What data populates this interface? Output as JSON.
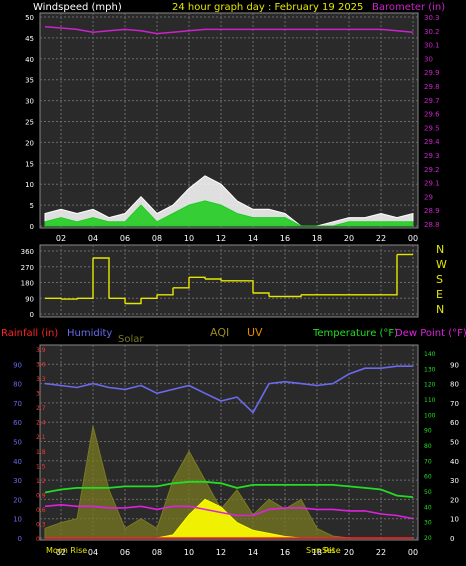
{
  "header": {
    "left_label": "Windspeed (mph)",
    "title": "24 hour graph day : February 19 2025",
    "right_label": "Barometer (in)"
  },
  "colors": {
    "background": "#000000",
    "plot_bg": "#2a2a2a",
    "grid": "#6a6a6a",
    "wind_gust": "#ffffff",
    "wind_avg": "#22cc22",
    "barometer": "#cc22cc",
    "direction": "#e6e600",
    "rainfall": "#ff2222",
    "humidity": "#6a6aee",
    "solar": "#7a7a22",
    "aqi": "#9a8a20",
    "uv": "#e08a00",
    "temperature": "#22dd22",
    "dew_point": "#dd22dd",
    "rain_axis": "#ff3333",
    "temp_axis": "#22dd22",
    "fill_yellow": "#ffff00"
  },
  "x_axis": {
    "ticks": [
      "02",
      "04",
      "06",
      "08",
      "10",
      "12",
      "14",
      "16",
      "18",
      "20",
      "22",
      "00"
    ],
    "sun_moon_labels": [
      "Moon Rise",
      "Sun Rise",
      "Set"
    ]
  },
  "panel1": {
    "left_ticks": [
      "0",
      "5",
      "10",
      "15",
      "20",
      "25",
      "30",
      "35",
      "40",
      "45",
      "50"
    ],
    "right_ticks": [
      "28.8",
      "28.9",
      "29",
      "29.1",
      "29.2",
      "29.3",
      "29.4",
      "29.5",
      "29.6",
      "29.7",
      "29.8",
      "29.9",
      "30",
      "30.1",
      "30.2",
      "30.3"
    ]
  },
  "panel2": {
    "left_ticks": [
      "0",
      "90",
      "180",
      "270",
      "360"
    ],
    "compass": [
      "N",
      "W",
      "S",
      "E",
      "N"
    ]
  },
  "panel3": {
    "legend": {
      "rainfall": "Rainfall (in)",
      "humidity": "Humidity",
      "solar": "Solar",
      "aqi": "AQI",
      "uv": "UV",
      "temperature": "Temperature (°F)",
      "dew_point": "Dew Point (°F)"
    },
    "humidity_ticks": [
      "0",
      "10",
      "20",
      "30",
      "40",
      "50",
      "60",
      "70",
      "80",
      "90"
    ],
    "rain_ticks": [
      "0",
      "0.3",
      "0.6",
      "0.9",
      "1.2",
      "1.5",
      "1.8",
      "2.1",
      "2.4",
      "2.7",
      "3",
      "3.3",
      "3.6",
      "3.9"
    ],
    "temp_ticks": [
      "20",
      "30",
      "40",
      "50",
      "60",
      "70",
      "80",
      "90",
      "100",
      "110",
      "120",
      "130",
      "140"
    ],
    "right_ticks": [
      "0",
      "10",
      "20",
      "30",
      "40",
      "50",
      "60",
      "70",
      "80",
      "90"
    ]
  },
  "chart_data": [
    {
      "type": "line",
      "title": "24 hour graph day : February 19 2025",
      "x": [
        "01",
        "02",
        "03",
        "04",
        "05",
        "06",
        "07",
        "08",
        "09",
        "10",
        "11",
        "12",
        "13",
        "14",
        "15",
        "16",
        "17",
        "18",
        "19",
        "20",
        "21",
        "22",
        "23",
        "00"
      ],
      "series": [
        {
          "name": "Windspeed (mph)",
          "values": [
            3,
            4,
            3,
            4,
            2,
            3,
            7,
            3,
            5,
            9,
            12,
            10,
            6,
            4,
            4,
            3,
            0,
            0,
            1,
            2,
            2,
            3,
            2,
            3
          ]
        },
        {
          "name": "Windspeed (mph)",
          "values": [
            1,
            2,
            1,
            2,
            1,
            1,
            5,
            1,
            3,
            5,
            6,
            5,
            3,
            2,
            2,
            2,
            0,
            0,
            0,
            1,
            1,
            1,
            1,
            1
          ]
        },
        {
          "name": "Barometer (in)",
          "values": [
            30.23,
            30.22,
            30.21,
            30.19,
            30.2,
            30.21,
            30.2,
            30.18,
            30.19,
            30.2,
            30.21,
            30.21,
            30.21,
            30.21,
            30.21,
            30.21,
            30.21,
            30.21,
            30.21,
            30.21,
            30.21,
            30.21,
            30.2,
            30.19
          ]
        }
      ],
      "ylim": [
        0,
        50
      ],
      "y2lim": [
        28.8,
        30.3
      ],
      "ylabel": "Windspeed (mph)",
      "y2label": "Barometer (in)"
    },
    {
      "type": "line",
      "x": [
        "01",
        "02",
        "03",
        "04",
        "05",
        "06",
        "07",
        "08",
        "09",
        "10",
        "11",
        "12",
        "13",
        "14",
        "15",
        "16",
        "17",
        "18",
        "19",
        "20",
        "21",
        "22",
        "23",
        "00"
      ],
      "series": [
        {
          "values": [
            90,
            85,
            90,
            320,
            90,
            60,
            90,
            110,
            150,
            210,
            200,
            190,
            190,
            120,
            100,
            100,
            110,
            110,
            110,
            110,
            110,
            110,
            340,
            340
          ]
        }
      ],
      "ylim": [
        0,
        360
      ]
    },
    {
      "type": "line",
      "x": [
        "01",
        "02",
        "03",
        "04",
        "05",
        "06",
        "07",
        "08",
        "09",
        "10",
        "11",
        "12",
        "13",
        "14",
        "15",
        "16",
        "17",
        "18",
        "19",
        "20",
        "21",
        "22",
        "23",
        "00"
      ],
      "series": [
        {
          "name": "Humidity",
          "values": [
            80,
            79,
            78,
            80,
            78,
            77,
            79,
            75,
            77,
            79,
            75,
            71,
            73,
            65,
            80,
            81,
            80,
            79,
            80,
            85,
            88,
            88,
            89,
            89
          ]
        },
        {
          "name": "Temperature (°F)",
          "values": [
            49,
            51,
            52,
            52,
            52,
            53,
            53,
            53,
            55,
            56,
            56,
            55,
            52,
            54,
            54,
            54,
            54,
            54,
            54,
            53,
            52,
            51,
            47,
            46
          ]
        },
        {
          "name": "Dew Point (°F)",
          "values": [
            40,
            41,
            40,
            40,
            39,
            39,
            40,
            38,
            40,
            40,
            38,
            36,
            34,
            34,
            38,
            39,
            39,
            38,
            38,
            37,
            37,
            35,
            34,
            32
          ]
        },
        {
          "name": "Rainfall (in)",
          "values": [
            0,
            0,
            0,
            0,
            0,
            0,
            0,
            0,
            0,
            0,
            0,
            0,
            0,
            0,
            0,
            0,
            0,
            0,
            0,
            0,
            0,
            0,
            0,
            0
          ]
        },
        {
          "name": "Solar",
          "values": [
            5,
            8,
            10,
            58,
            25,
            5,
            10,
            5,
            30,
            45,
            30,
            15,
            25,
            12,
            20,
            15,
            20,
            5,
            1,
            0,
            0,
            0,
            0,
            0
          ]
        },
        {
          "name": "UV",
          "values": [
            0,
            0,
            0,
            0,
            0,
            0,
            0,
            0,
            0.2,
            1.5,
            2.5,
            2,
            1,
            0.5,
            0.3,
            0.1,
            0,
            0,
            0,
            0,
            0,
            0,
            0,
            0
          ]
        }
      ],
      "ylim": [
        0,
        100
      ],
      "y2lim": [
        20,
        140
      ]
    }
  ]
}
